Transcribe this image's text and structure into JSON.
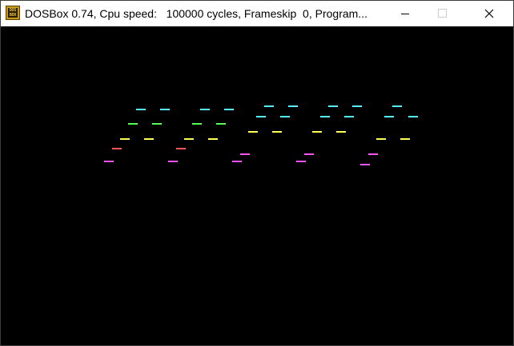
{
  "window": {
    "title": "DOSBox 0.74, Cpu speed:   100000 cycles, Frameskip  0, Program...",
    "icon": "dosbox-icon",
    "icon_text": "DOS BOX"
  },
  "controls": {
    "minimize_icon": "minimize-icon",
    "maximize_icon": "maximize-icon",
    "close_icon": "close-icon"
  },
  "palette": {
    "cyan": "#55ffff",
    "green": "#55ff55",
    "yellow": "#ffff55",
    "red": "#ff5555",
    "magenta": "#ff55ff"
  }
}
